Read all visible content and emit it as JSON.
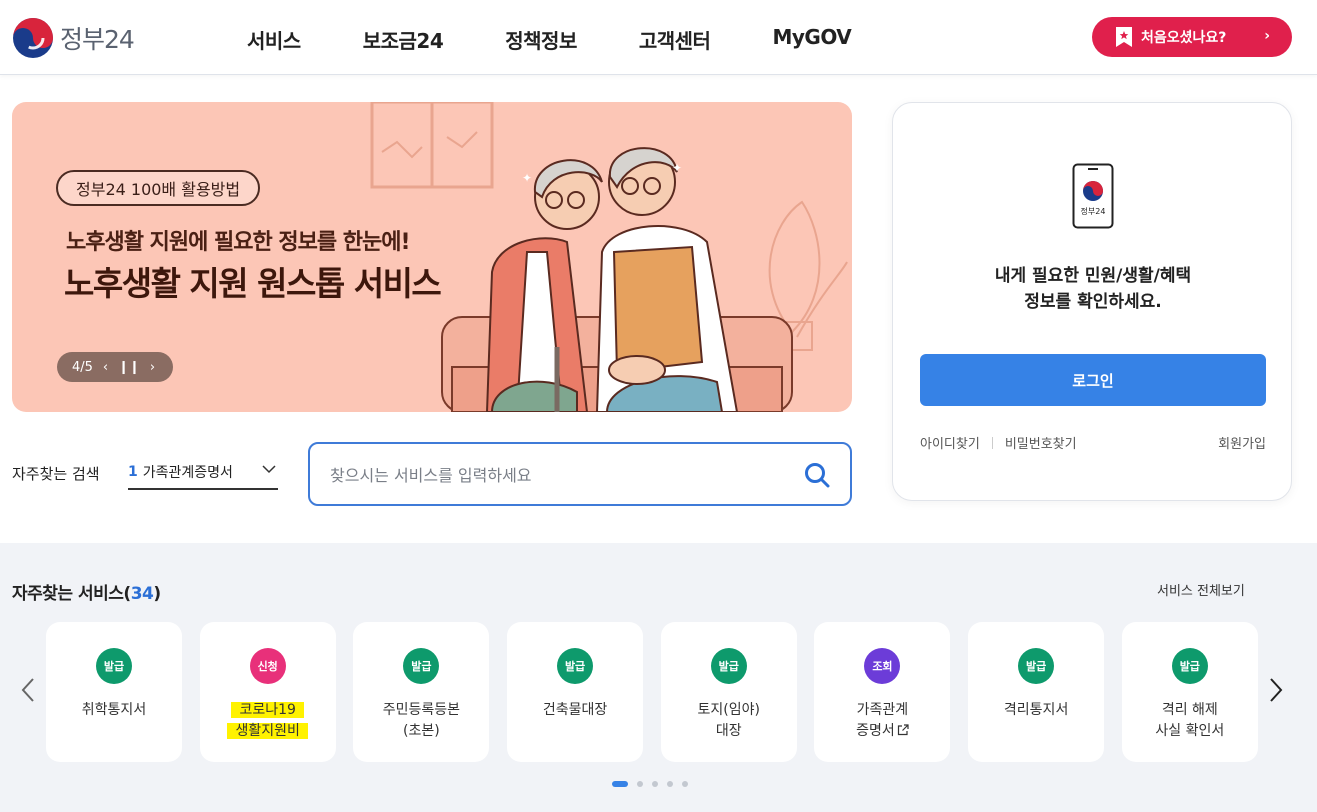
{
  "header": {
    "logo_text": "정부24",
    "nav": [
      "서비스",
      "보조금24",
      "정책정보",
      "고객센터",
      "MyGOV"
    ],
    "first_visit_button": "처음오셨나요?"
  },
  "banner": {
    "tag": "정부24 100배 활용방법",
    "subtitle": "노후생활 지원에 필요한 정보를 한눈에!",
    "title": "노후생활 지원 원스톱 서비스",
    "page": "4/5"
  },
  "search": {
    "frequent_label": "자주찾는 검색",
    "frequent_rank": "1",
    "frequent_term": "가족관계증명서",
    "placeholder": "찾으시는 서비스를 입력하세요"
  },
  "login": {
    "device_label": "정부24",
    "message_line1": "내게 필요한 민원/생활/혜택",
    "message_line2": "정보를 확인하세요.",
    "login_button": "로그인",
    "find_id": "아이디찾기",
    "find_password": "비밀번호찾기",
    "signup": "회원가입"
  },
  "services": {
    "title": "자주찾는 서비스",
    "count": "34",
    "view_all": "서비스 전체보기",
    "cards": [
      {
        "badge": "발급",
        "badge_color": "#0e9a6c",
        "line1": "취학통지서",
        "line2": ""
      },
      {
        "badge": "신청",
        "badge_color": "#e8307a",
        "line1": "코로나19",
        "line2": "생활지원비"
      },
      {
        "badge": "발급",
        "badge_color": "#0e9a6c",
        "line1": "주민등록등본",
        "line2": "(초본)"
      },
      {
        "badge": "발급",
        "badge_color": "#0e9a6c",
        "line1": "건축물대장",
        "line2": ""
      },
      {
        "badge": "발급",
        "badge_color": "#0e9a6c",
        "line1": "토지(임야)",
        "line2": "대장"
      },
      {
        "badge": "조회",
        "badge_color": "#6c3cd8",
        "line1": "가족관계",
        "line2": "증명서"
      },
      {
        "badge": "발급",
        "badge_color": "#0e9a6c",
        "line1": "격리통지서",
        "line2": ""
      },
      {
        "badge": "발급",
        "badge_color": "#0e9a6c",
        "line1": "격리 해제",
        "line2": "사실 확인서"
      }
    ],
    "pages": 5,
    "active_page": 1
  }
}
